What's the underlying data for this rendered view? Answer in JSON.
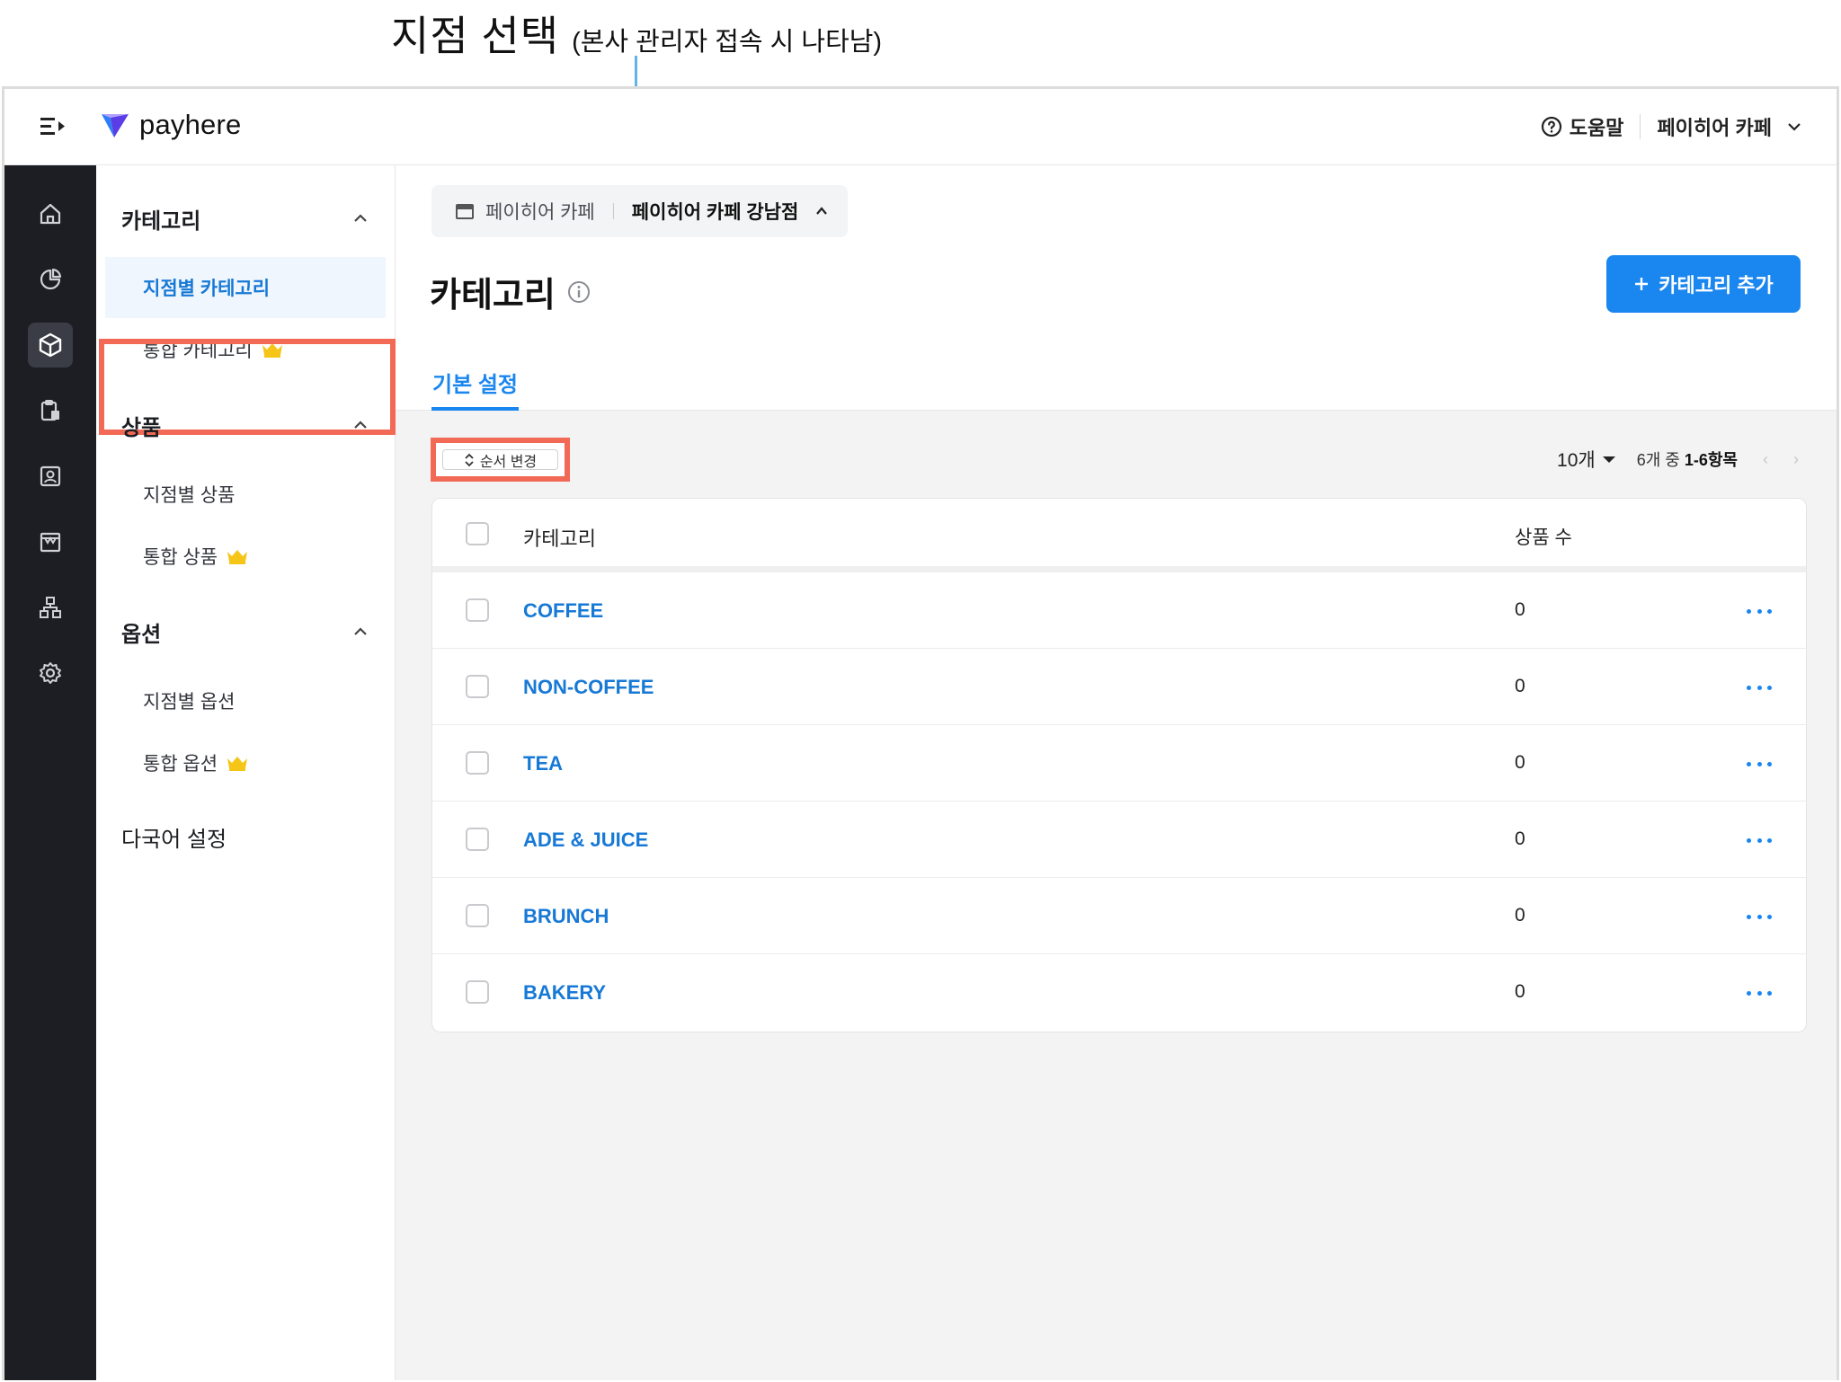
{
  "annotation": {
    "title": "지점 선택",
    "subtitle": "(본사 관리자 접속 시 나타남)"
  },
  "header": {
    "logo_text": "payhere",
    "help_label": "도움말",
    "store_name": "페이히어 카페"
  },
  "icon_sidebar": [
    "home-icon",
    "chart-icon",
    "box-icon",
    "clipboard-icon",
    "contact-icon",
    "store-icon",
    "org-chart-icon",
    "gear-icon"
  ],
  "subnav": {
    "sections": [
      {
        "title": "카테고리",
        "items": [
          {
            "label": "지점별 카테고리",
            "active": true
          },
          {
            "label": "통합 카테고리",
            "crown": true
          }
        ]
      },
      {
        "title": "상품",
        "items": [
          {
            "label": "지점별 상품"
          },
          {
            "label": "통합 상품",
            "crown": true
          }
        ]
      },
      {
        "title": "옵션",
        "items": [
          {
            "label": "지점별 옵션"
          },
          {
            "label": "통합 옵션",
            "crown": true
          }
        ]
      }
    ],
    "multilang": "다국어 설정"
  },
  "branch": {
    "parent": "페이히어 카페",
    "current": "페이히어 카페 강남점"
  },
  "page": {
    "title": "카테고리",
    "add_button": "카테고리 추가",
    "tab": "기본 설정"
  },
  "toolbar": {
    "reorder_label": "순서 변경",
    "per_page": "10개",
    "range_prefix": "6개 중",
    "range": "1-6항목"
  },
  "table": {
    "headers": {
      "category": "카테고리",
      "count": "상품 수"
    },
    "rows": [
      {
        "name": "COFFEE",
        "count": "0"
      },
      {
        "name": "NON-COFFEE",
        "count": "0"
      },
      {
        "name": "TEA",
        "count": "0"
      },
      {
        "name": "ADE & JUICE",
        "count": "0"
      },
      {
        "name": "BRUNCH",
        "count": "0"
      },
      {
        "name": "BAKERY",
        "count": "0"
      }
    ]
  },
  "colors": {
    "accent": "#1a86f0",
    "highlight": "#f26955",
    "sidebar_bg": "#1c1e23",
    "crown": "#f5c518",
    "annotation_line": "#5fb4ec"
  }
}
